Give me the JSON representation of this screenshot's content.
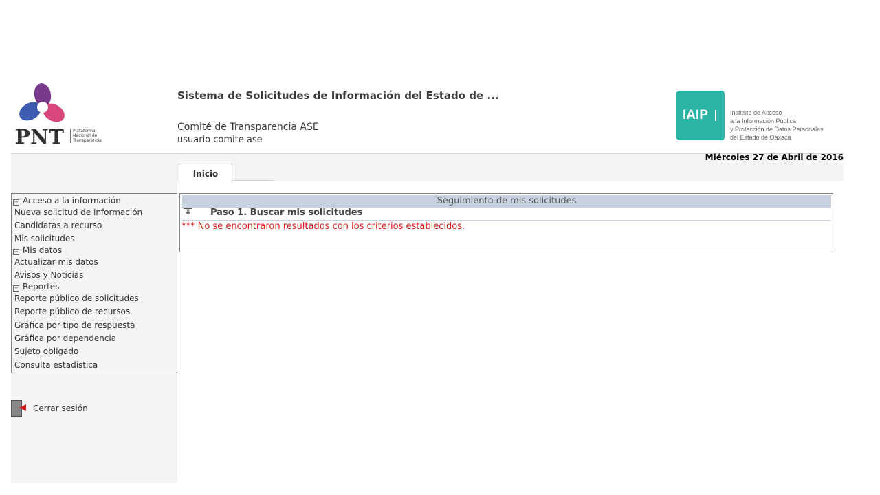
{
  "header": {
    "system_title": "Sistema de Solicitudes de Información del Estado de ...",
    "committee": "Comité de Transparencia ASE",
    "user": "usuario comite ase",
    "date": "Miércoles 27 de Abril de 2016",
    "pnt_logo": {
      "text": "PNT",
      "subtitle": [
        "Plataforma",
        "Nacional de",
        "Transparencia"
      ]
    },
    "iaip_logo": {
      "text": "IAIP",
      "lines": [
        "Instituto de Acceso",
        "a la Información Pública",
        "y Protección de Datos Personales",
        "del Estado de Oaxaca"
      ]
    }
  },
  "tabs": [
    {
      "label": "Inicio",
      "active": true
    }
  ],
  "sidebar": {
    "items": [
      {
        "label": "Acceso a la información",
        "section": true
      },
      {
        "label": "Nueva solicitud de información",
        "section": false
      },
      {
        "label": "Candidatas a recurso",
        "section": false
      },
      {
        "label": "Mis solicitudes",
        "section": false
      },
      {
        "label": "Mis datos",
        "section": true
      },
      {
        "label": "Actualizar mis datos",
        "section": false
      },
      {
        "label": "Avisos y Noticias",
        "section": false
      },
      {
        "label": "Reportes",
        "section": true
      },
      {
        "label": "Reporte público de solicitudes",
        "section": false
      },
      {
        "label": "Reporte público de recursos",
        "section": false
      },
      {
        "label": "Gráfica por tipo de respuesta",
        "section": false
      },
      {
        "label": "Gráfica por dependencia",
        "section": false
      },
      {
        "label": "Sujeto obligado",
        "section": false
      },
      {
        "label": "Consulta estadística",
        "section": false
      }
    ],
    "logout_label": "Cerrar sesión"
  },
  "main": {
    "panel_title": "Seguimiento de mis solicitudes",
    "step_label": "Paso 1. Buscar mis solicitudes",
    "message": "*** No se encontraron resultados con los criterios establecidos."
  },
  "colors": {
    "accent_teal": "#2bb3a4",
    "panel_header": "#c7d1df",
    "error_red": "#e01616"
  }
}
